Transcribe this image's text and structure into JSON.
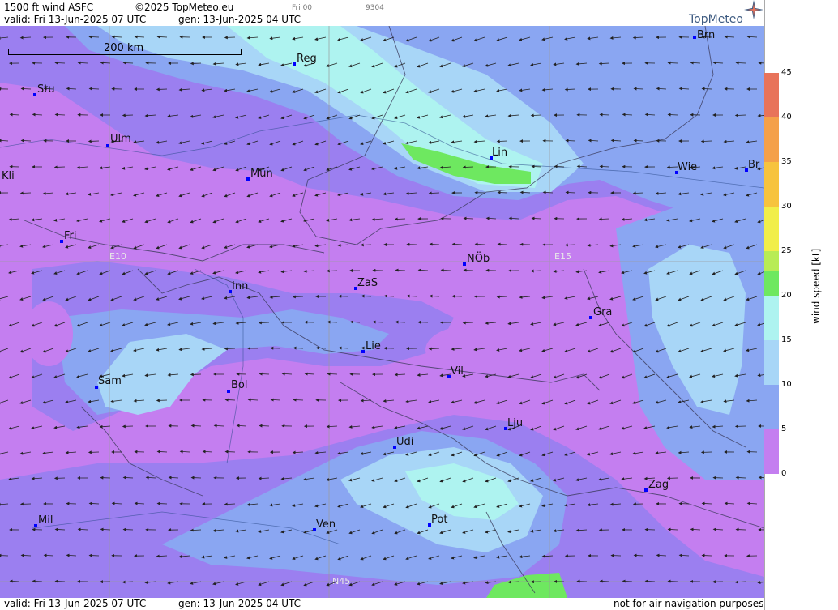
{
  "header": {
    "product": "1500 ft wind ASFC",
    "copyright": "©2025 TopMeteo.eu",
    "valid": "valid:  Fri  13-Jun-2025  07 UTC",
    "gen": "gen: 13-Jun-2025 04 UTC",
    "day_code": "Fri 00",
    "run_code": "9304",
    "logo": "TopMeteo"
  },
  "footer": {
    "valid": "valid:  Fri  13-Jun-2025  07 UTC",
    "gen": "gen: 13-Jun-2025 04 UTC",
    "disclaimer": "not for air navigation purposes"
  },
  "scale": {
    "label": "200 km"
  },
  "grid_labels": {
    "lon1": "E10",
    "lon2": "E15",
    "lat1": "N45"
  },
  "cities": [
    {
      "id": "brn",
      "name": "Brn"
    },
    {
      "id": "reg",
      "name": "Reg"
    },
    {
      "id": "stu",
      "name": "Stu"
    },
    {
      "id": "ulm",
      "name": "Ulm"
    },
    {
      "id": "lin",
      "name": "Lin"
    },
    {
      "id": "wie",
      "name": "Wie"
    },
    {
      "id": "br",
      "name": "Br"
    },
    {
      "id": "kli",
      "name": "Kli"
    },
    {
      "id": "mun",
      "name": "Mün"
    },
    {
      "id": "fri",
      "name": "Fri"
    },
    {
      "id": "nob",
      "name": "NÖb"
    },
    {
      "id": "inn",
      "name": "Inn"
    },
    {
      "id": "zas",
      "name": "ZaS"
    },
    {
      "id": "gra",
      "name": "Gra"
    },
    {
      "id": "lie",
      "name": "Lie"
    },
    {
      "id": "vil",
      "name": "Vil"
    },
    {
      "id": "sam",
      "name": "Sam"
    },
    {
      "id": "bol",
      "name": "Bol"
    },
    {
      "id": "lju",
      "name": "Lju"
    },
    {
      "id": "udi",
      "name": "Udi"
    },
    {
      "id": "zag",
      "name": "Zag"
    },
    {
      "id": "mil",
      "name": "Mil"
    },
    {
      "id": "ven",
      "name": "Ven"
    },
    {
      "id": "pot",
      "name": "Pot"
    }
  ],
  "legend": {
    "title": "wind  speed  [kt]",
    "ticks": [
      "45",
      "40",
      "35",
      "30",
      "25",
      "20",
      "15",
      "10",
      "5",
      "0"
    ],
    "colors": [
      "#e8735a",
      "#f4a04a",
      "#f7c33e",
      "#f1ee4a",
      "#b8ec55",
      "#6ee860",
      "#aef3f0",
      "#a8d6f7",
      "#8aa6f2",
      "#9b7ff0",
      "#c47ef0"
    ]
  },
  "colors": {
    "calm": "#c47ef0",
    "light": "#9b7ff0",
    "moderate": "#8aa6f2",
    "fresh": "#a8d6f7",
    "strong": "#aef3f0",
    "max": "#6ee860"
  }
}
